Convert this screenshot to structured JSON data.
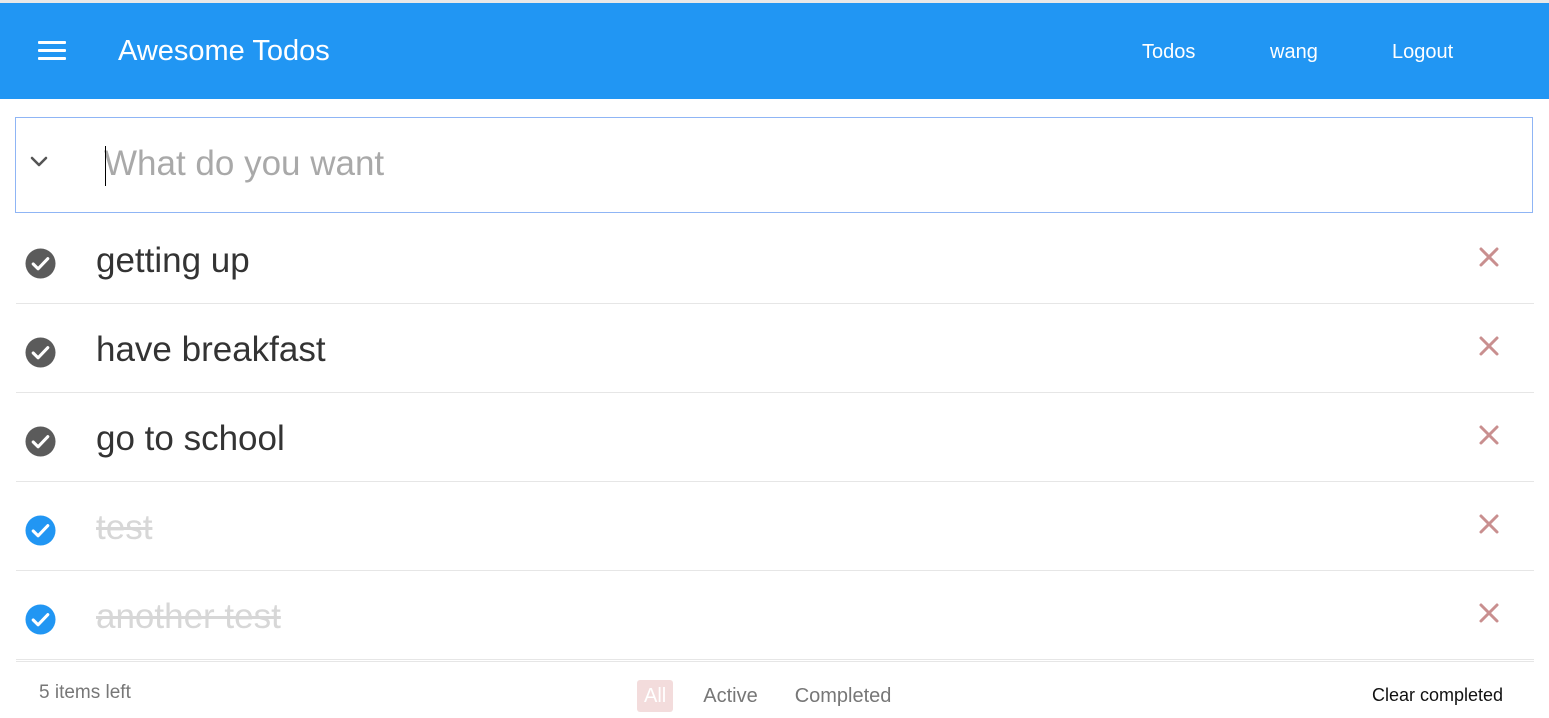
{
  "appbar": {
    "title": "Awesome Todos",
    "nav": [
      {
        "label": "Todos"
      },
      {
        "label": "wang"
      },
      {
        "label": "Logout"
      }
    ]
  },
  "new_todo": {
    "placeholder": "What do you want",
    "value": ""
  },
  "todos": [
    {
      "text": "getting up",
      "completed": false
    },
    {
      "text": "have breakfast",
      "completed": false
    },
    {
      "text": "go to school",
      "completed": false
    },
    {
      "text": "test",
      "completed": true
    },
    {
      "text": "another test",
      "completed": true
    }
  ],
  "footer": {
    "items_left": "5 items left",
    "filters": [
      {
        "label": "All",
        "selected": true
      },
      {
        "label": "Active",
        "selected": false
      },
      {
        "label": "Completed",
        "selected": false
      }
    ],
    "clear_completed": "Clear completed"
  },
  "colors": {
    "appbar": "#2196f3",
    "check_active": "#5b5b5b",
    "check_completed": "#2196f3",
    "destroy": "#c98f8f",
    "filter_selected_bg": "#f3dcdc"
  },
  "icons": {
    "menu": "hamburger-menu-icon",
    "toggle_all": "chevron-down-icon",
    "check": "check-circle-icon",
    "destroy": "close-x-icon"
  }
}
